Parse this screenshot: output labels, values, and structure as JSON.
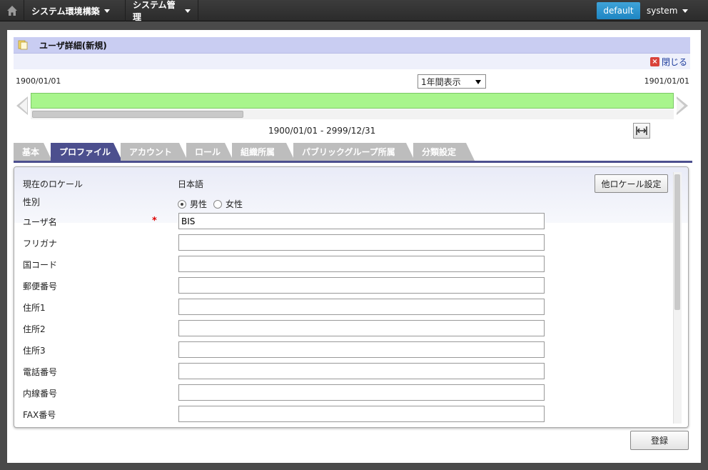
{
  "topbar": {
    "menu1": "システム環境構築",
    "menu2": "システム管理",
    "default_button": "default",
    "user": "system"
  },
  "header": {
    "title": "ユーザ詳細(新規)",
    "close": "閉じる"
  },
  "timeline": {
    "start_date": "1900/01/01",
    "end_date": "1901/01/01",
    "range_option": "1年間表示",
    "period": "1900/01/01 - 2999/12/31"
  },
  "tabs": [
    "基本",
    "プロファイル",
    "アカウント",
    "ロール",
    "組織所属",
    "パブリックグループ所属",
    "分類設定"
  ],
  "form": {
    "locale_label": "現在のロケール",
    "locale_value": "日本語",
    "locale_button": "他ロケール設定",
    "gender_label": "性別",
    "gender_male": "男性",
    "gender_female": "女性",
    "username_label": "ユーザ名",
    "required_mark": "*",
    "username_value": "BIS",
    "furigana_label": "フリガナ",
    "country_label": "国コード",
    "postal_label": "郵便番号",
    "address1_label": "住所1",
    "address2_label": "住所2",
    "address3_label": "住所3",
    "phone_label": "電話番号",
    "extension_label": "内線番号",
    "fax_label": "FAX番号"
  },
  "footer": {
    "register": "登録"
  },
  "colors": {
    "accent": "#4c4f8e",
    "timeline_fill": "#a8f58c",
    "default_btn": "#2a93ce"
  }
}
